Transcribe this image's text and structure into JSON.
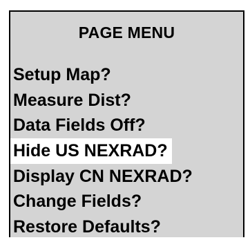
{
  "menu": {
    "title": "PAGE MENU",
    "items": [
      {
        "label": "Setup Map?",
        "selected": false
      },
      {
        "label": "Measure Dist?",
        "selected": false
      },
      {
        "label": "Data Fields Off?",
        "selected": false
      },
      {
        "label": "Hide US NEXRAD?",
        "selected": true
      },
      {
        "label": "Display CN NEXRAD?",
        "selected": false
      },
      {
        "label": "Change Fields?",
        "selected": false
      },
      {
        "label": "Restore Defaults?",
        "selected": false
      }
    ]
  },
  "colors": {
    "panel_background": "#d4d4d4",
    "border": "#000000",
    "highlight": "#ffffff",
    "text": "#000000"
  }
}
